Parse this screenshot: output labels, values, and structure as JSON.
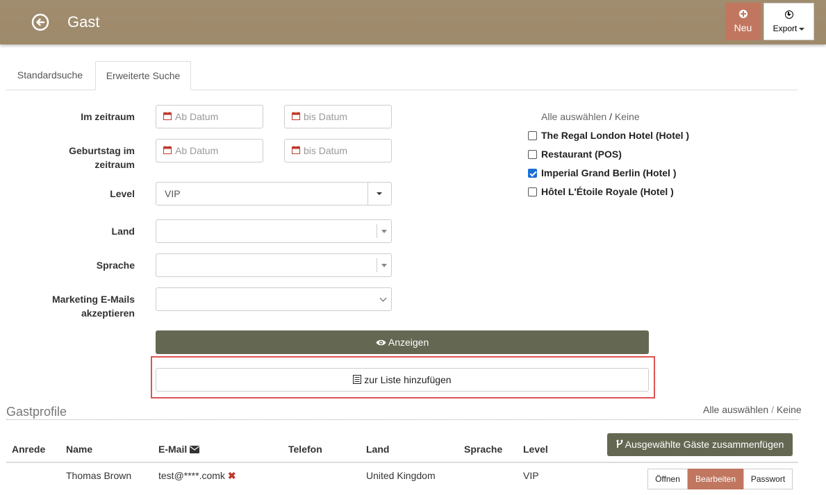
{
  "header": {
    "title": "Gast",
    "new_label": "Neu",
    "export_label": "Export"
  },
  "tabs": [
    {
      "label": "Standardsuche",
      "active": false
    },
    {
      "label": "Erweiterte Suche",
      "active": true
    }
  ],
  "form": {
    "period_label": "Im zeitraum",
    "birthday_label_1": "Geburtstag im",
    "birthday_label_2": "zeitraum",
    "from_placeholder": "Ab Datum",
    "to_placeholder": "bis Datum",
    "level_label": "Level",
    "level_value": "VIP",
    "country_label": "Land",
    "language_label": "Sprache",
    "marketing_label_1": "Marketing E-Mails",
    "marketing_label_2": "akzeptieren"
  },
  "hotels": {
    "select_all": "Alle auswählen",
    "separator": "/",
    "none": "Keine",
    "items": [
      {
        "label": "The Regal London Hotel (Hotel )",
        "checked": false
      },
      {
        "label": "Restaurant (POS)",
        "checked": false
      },
      {
        "label": "Imperial Grand Berlin (Hotel )",
        "checked": true
      },
      {
        "label": "Hôtel L'Étoile Royale (Hotel )",
        "checked": false
      }
    ]
  },
  "actions": {
    "show_label": "Anzeigen",
    "add_to_list_label": "zur Liste hinzufügen"
  },
  "profiles": {
    "title": "Gastprofile",
    "select_all": "Alle auswählen",
    "separator": "/",
    "none": "Keine",
    "merge_label": "Ausgewählte Gäste zusammenfügen",
    "columns": [
      "Anrede",
      "Name",
      "E-Mail",
      "Telefon",
      "Land",
      "Sprache",
      "Level"
    ],
    "rows": [
      {
        "salutation": "",
        "name": "Thomas Brown",
        "email": "test@****.comk",
        "phone": "",
        "country": "United Kingdom",
        "language": "",
        "level": "VIP",
        "open_label": "Öffnen",
        "edit_label": "Bearbeiten",
        "password_label": "Passwort"
      }
    ]
  },
  "colors": {
    "header": "#a08c6e",
    "accent": "#c1775f",
    "primary_button": "#646852",
    "highlight_border": "#e05252",
    "checkbox_checked": "#1a6fd8"
  }
}
